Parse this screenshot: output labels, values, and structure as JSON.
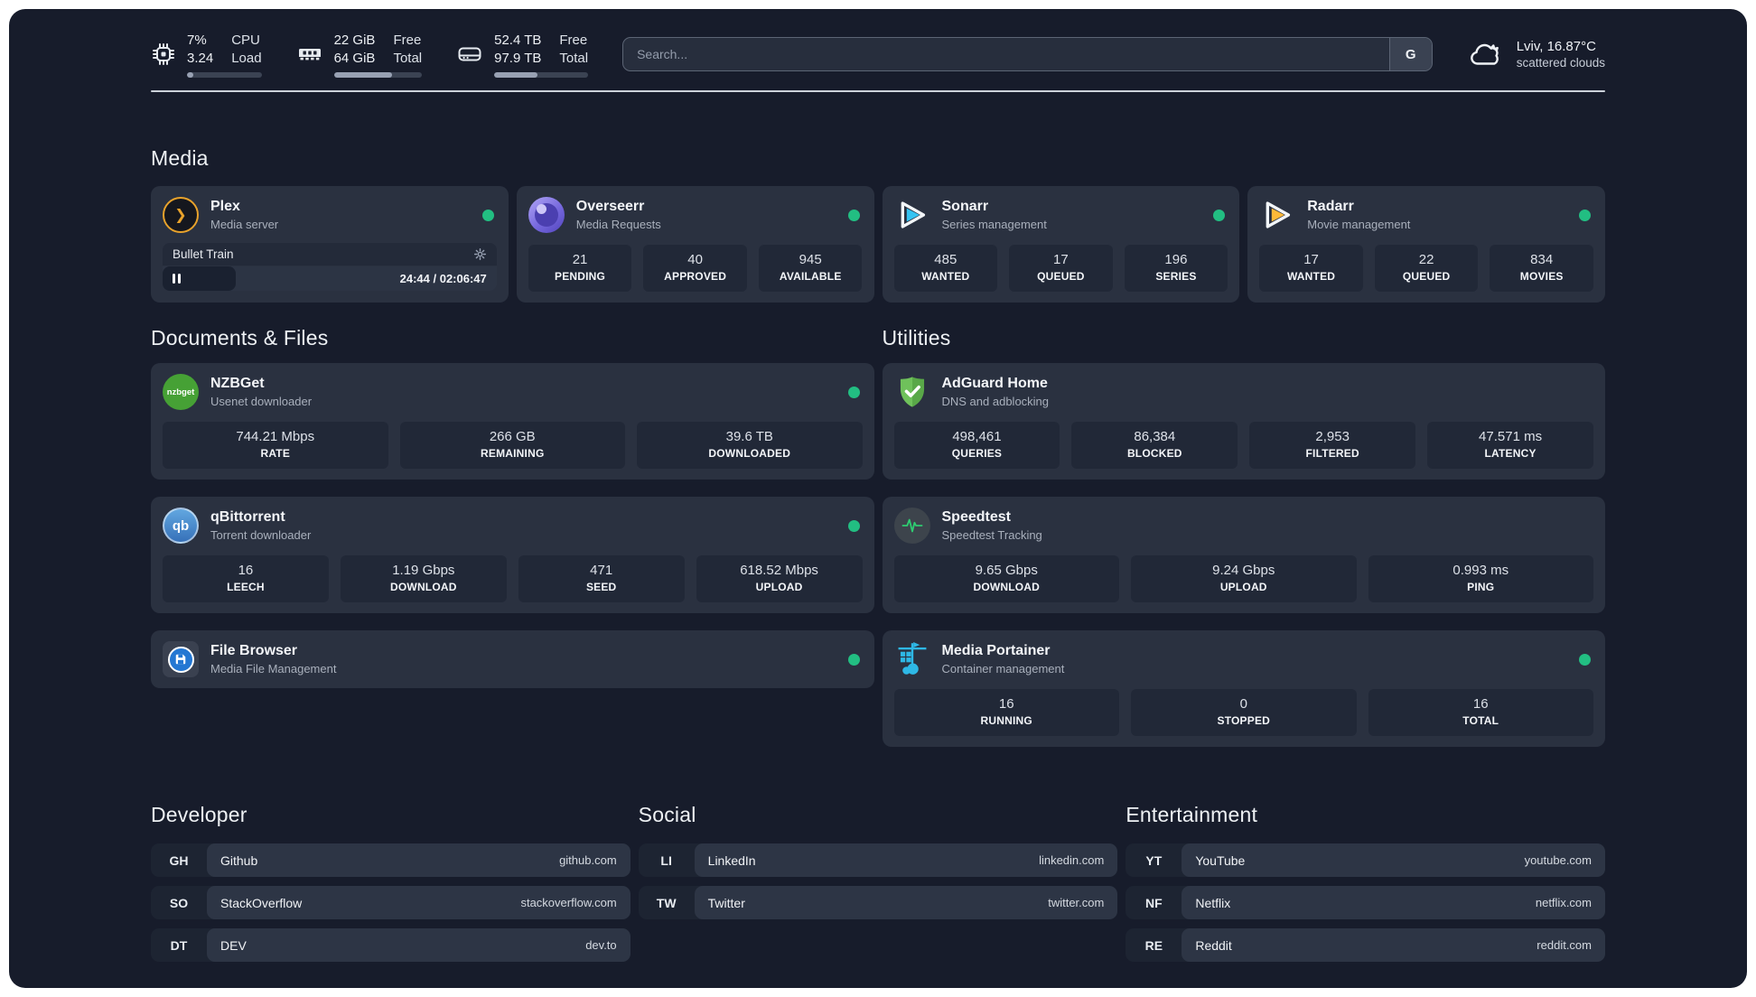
{
  "topbar": {
    "cpu": {
      "value1": "7%",
      "value2": "3.24",
      "label1": "CPU",
      "label2": "Load",
      "progress": 8
    },
    "ram": {
      "value1": "22 GiB",
      "value2": "64 GiB",
      "label1": "Free",
      "label2": "Total",
      "progress": 66
    },
    "disk": {
      "value1": "52.4 TB",
      "value2": "97.9 TB",
      "label1": "Free",
      "label2": "Total",
      "progress": 46
    },
    "search": {
      "placeholder": "Search...",
      "provider": "G"
    },
    "weather": {
      "location": "Lviv, 16.87°C",
      "condition": "scattered clouds"
    }
  },
  "media": {
    "title": "Media",
    "plex": {
      "name": "Plex",
      "subtitle": "Media server",
      "icon_glyph": "❯",
      "now_playing": "Bullet Train",
      "time": "24:44 / 02:06:47",
      "progress": 22
    },
    "overseerr": {
      "name": "Overseerr",
      "subtitle": "Media Requests",
      "stats": [
        {
          "value": "21",
          "label": "PENDING"
        },
        {
          "value": "40",
          "label": "APPROVED"
        },
        {
          "value": "945",
          "label": "AVAILABLE"
        }
      ]
    },
    "sonarr": {
      "name": "Sonarr",
      "subtitle": "Series management",
      "stats": [
        {
          "value": "485",
          "label": "WANTED"
        },
        {
          "value": "17",
          "label": "QUEUED"
        },
        {
          "value": "196",
          "label": "SERIES"
        }
      ]
    },
    "radarr": {
      "name": "Radarr",
      "subtitle": "Movie management",
      "stats": [
        {
          "value": "17",
          "label": "WANTED"
        },
        {
          "value": "22",
          "label": "QUEUED"
        },
        {
          "value": "834",
          "label": "MOVIES"
        }
      ]
    }
  },
  "documents": {
    "title": "Documents & Files",
    "nzbget": {
      "name": "NZBGet",
      "subtitle": "Usenet downloader",
      "icon_text": "nzbget",
      "stats": [
        {
          "value": "744.21 Mbps",
          "label": "RATE"
        },
        {
          "value": "266 GB",
          "label": "REMAINING"
        },
        {
          "value": "39.6 TB",
          "label": "DOWNLOADED"
        }
      ]
    },
    "qbittorrent": {
      "name": "qBittorrent",
      "subtitle": "Torrent downloader",
      "icon_text": "qb",
      "stats": [
        {
          "value": "16",
          "label": "LEECH"
        },
        {
          "value": "1.19 Gbps",
          "label": "DOWNLOAD"
        },
        {
          "value": "471",
          "label": "SEED"
        },
        {
          "value": "618.52 Mbps",
          "label": "UPLOAD"
        }
      ]
    },
    "filebrowser": {
      "name": "File Browser",
      "subtitle": "Media File Management"
    }
  },
  "utilities": {
    "title": "Utilities",
    "adguard": {
      "name": "AdGuard Home",
      "subtitle": "DNS and adblocking",
      "stats": [
        {
          "value": "498,461",
          "label": "QUERIES"
        },
        {
          "value": "86,384",
          "label": "BLOCKED"
        },
        {
          "value": "2,953",
          "label": "FILTERED"
        },
        {
          "value": "47.571 ms",
          "label": "LATENCY"
        }
      ]
    },
    "speedtest": {
      "name": "Speedtest",
      "subtitle": "Speedtest Tracking",
      "stats": [
        {
          "value": "9.65 Gbps",
          "label": "DOWNLOAD"
        },
        {
          "value": "9.24 Gbps",
          "label": "UPLOAD"
        },
        {
          "value": "0.993 ms",
          "label": "PING"
        }
      ]
    },
    "portainer": {
      "name": "Media Portainer",
      "subtitle": "Container management",
      "stats": [
        {
          "value": "16",
          "label": "RUNNING"
        },
        {
          "value": "0",
          "label": "STOPPED"
        },
        {
          "value": "16",
          "label": "TOTAL"
        }
      ]
    }
  },
  "bookmarks": [
    {
      "title": "Developer",
      "items": [
        {
          "abbr": "GH",
          "name": "Github",
          "url": "github.com"
        },
        {
          "abbr": "SO",
          "name": "StackOverflow",
          "url": "stackoverflow.com"
        },
        {
          "abbr": "DT",
          "name": "DEV",
          "url": "dev.to"
        }
      ]
    },
    {
      "title": "Social",
      "items": [
        {
          "abbr": "LI",
          "name": "LinkedIn",
          "url": "linkedin.com"
        },
        {
          "abbr": "TW",
          "name": "Twitter",
          "url": "twitter.com"
        }
      ]
    },
    {
      "title": "Entertainment",
      "items": [
        {
          "abbr": "YT",
          "name": "YouTube",
          "url": "youtube.com"
        },
        {
          "abbr": "NF",
          "name": "Netflix",
          "url": "netflix.com"
        },
        {
          "abbr": "RE",
          "name": "Reddit",
          "url": "reddit.com"
        }
      ]
    }
  ],
  "colors": {
    "status_online": "#22be82",
    "plex_accent": "#e8a22b",
    "sonarr_accent": "#35c3f2",
    "radarr_accent": "#ffb938",
    "adguard_green": "#66b855",
    "portainer_blue": "#2eb8e6",
    "speedtest_green": "#2ecc71",
    "nzbget_green": "#46a135",
    "qbittorrent_blue": "#3671b9"
  }
}
